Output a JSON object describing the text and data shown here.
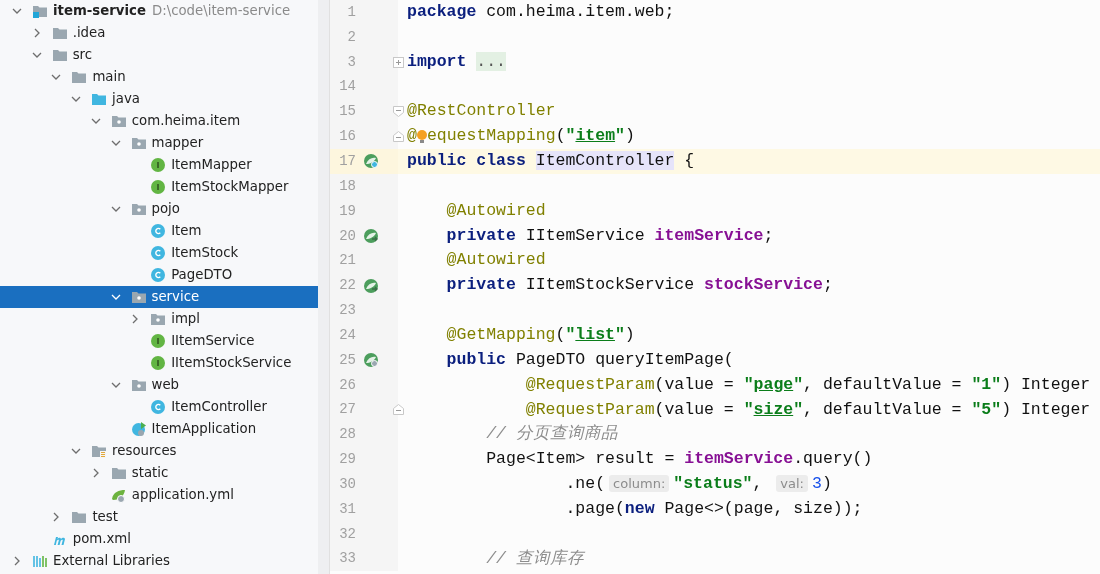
{
  "project_tree": [
    {
      "name": "item-service",
      "path": "D:\\code\\item-service",
      "kind": "module",
      "expanded": true,
      "selected": false,
      "children": [
        {
          "name": ".idea",
          "kind": "folder",
          "expanded": false,
          "selected": false
        },
        {
          "name": "src",
          "kind": "folder",
          "expanded": true,
          "selected": false,
          "children": [
            {
              "name": "main",
              "kind": "folder",
              "expanded": true,
              "selected": false,
              "children": [
                {
                  "name": "java",
                  "kind": "source-folder",
                  "expanded": true,
                  "selected": false,
                  "children": [
                    {
                      "name": "com.heima.item",
                      "kind": "package",
                      "expanded": true,
                      "selected": false,
                      "children": [
                        {
                          "name": "mapper",
                          "kind": "package",
                          "expanded": true,
                          "selected": false,
                          "children": [
                            {
                              "name": "ItemMapper",
                              "kind": "interface",
                              "selected": false
                            },
                            {
                              "name": "ItemStockMapper",
                              "kind": "interface",
                              "selected": false
                            }
                          ]
                        },
                        {
                          "name": "pojo",
                          "kind": "package",
                          "expanded": true,
                          "selected": false,
                          "children": [
                            {
                              "name": "Item",
                              "kind": "class",
                              "selected": false
                            },
                            {
                              "name": "ItemStock",
                              "kind": "class",
                              "selected": false
                            },
                            {
                              "name": "PageDTO",
                              "kind": "class",
                              "selected": false
                            }
                          ]
                        },
                        {
                          "name": "service",
                          "kind": "package",
                          "expanded": true,
                          "selected": true,
                          "children": [
                            {
                              "name": "impl",
                              "kind": "package",
                              "expanded": false,
                              "selected": false
                            },
                            {
                              "name": "IItemService",
                              "kind": "interface",
                              "selected": false
                            },
                            {
                              "name": "IItemStockService",
                              "kind": "interface",
                              "selected": false
                            }
                          ]
                        },
                        {
                          "name": "web",
                          "kind": "package",
                          "expanded": true,
                          "selected": false,
                          "children": [
                            {
                              "name": "ItemController",
                              "kind": "class",
                              "selected": false
                            }
                          ]
                        },
                        {
                          "name": "ItemApplication",
                          "kind": "spring-class",
                          "selected": false
                        }
                      ]
                    }
                  ]
                },
                {
                  "name": "resources",
                  "kind": "resources-folder",
                  "expanded": true,
                  "selected": false,
                  "children": [
                    {
                      "name": "static",
                      "kind": "folder",
                      "expanded": false,
                      "selected": false
                    },
                    {
                      "name": "application.yml",
                      "kind": "yml",
                      "selected": false
                    }
                  ]
                }
              ]
            },
            {
              "name": "test",
              "kind": "folder",
              "expanded": false,
              "selected": false
            }
          ]
        },
        {
          "name": "pom.xml",
          "kind": "maven",
          "selected": false
        }
      ]
    },
    {
      "name": "External Libraries",
      "kind": "libraries",
      "expanded": false,
      "selected": false
    }
  ],
  "editor": {
    "lines": [
      {
        "number": "1",
        "highlighted": false,
        "tokens": [
          {
            "kind": "keyword",
            "text": "package"
          },
          {
            "kind": "plain",
            "text": " com.heima.item.web;"
          }
        ]
      },
      {
        "number": "2",
        "highlighted": false
      },
      {
        "number": "3",
        "highlighted": false,
        "fold_marker": {
          "kind": "expand"
        },
        "tokens": [
          {
            "kind": "keyword",
            "text": "import "
          },
          {
            "kind": "folded",
            "text": "..."
          }
        ]
      },
      {
        "number": "14",
        "highlighted": false
      },
      {
        "number": "15",
        "highlighted": false,
        "fold_marker": {
          "kind": "collapse"
        },
        "tokens": [
          {
            "kind": "annotation",
            "text": "@RestController"
          }
        ]
      },
      {
        "number": "16",
        "highlighted": false,
        "fold_marker": {
          "kind": "end"
        },
        "tokens": [
          {
            "kind": "annotation",
            "text": "@"
          },
          {
            "kind": "bulb"
          },
          {
            "kind": "annotation",
            "text": "equestMapping"
          },
          {
            "kind": "plain",
            "text": "("
          },
          {
            "kind": "string",
            "text": "\""
          },
          {
            "kind": "string-link",
            "text": "item"
          },
          {
            "kind": "string",
            "text": "\""
          },
          {
            "kind": "plain",
            "text": ")"
          }
        ]
      },
      {
        "number": "17",
        "highlighted": true,
        "gutter_icon": {
          "kind": "bean-class"
        },
        "tokens": [
          {
            "kind": "keyword",
            "text": "public class "
          },
          {
            "kind": "usage",
            "text": "ItemController"
          },
          {
            "kind": "plain",
            "text": " {"
          }
        ]
      },
      {
        "number": "18",
        "highlighted": false
      },
      {
        "number": "19",
        "highlighted": false,
        "tokens": [
          {
            "kind": "annotation",
            "text": "    @Autowired"
          }
        ]
      },
      {
        "number": "20",
        "highlighted": false,
        "gutter_icon": {
          "kind": "bean-inject"
        },
        "tokens": [
          {
            "kind": "keyword",
            "text": "    private"
          },
          {
            "kind": "plain",
            "text": " IItemService "
          },
          {
            "kind": "field",
            "text": "itemService"
          },
          {
            "kind": "plain",
            "text": ";"
          }
        ]
      },
      {
        "number": "21",
        "highlighted": false,
        "tokens": [
          {
            "kind": "annotation",
            "text": "    @Autowired"
          }
        ]
      },
      {
        "number": "22",
        "highlighted": false,
        "gutter_icon": {
          "kind": "bean-inject"
        },
        "tokens": [
          {
            "kind": "keyword",
            "text": "    private"
          },
          {
            "kind": "plain",
            "text": " IItemStockService "
          },
          {
            "kind": "field",
            "text": "stockService"
          },
          {
            "kind": "plain",
            "text": ";"
          }
        ]
      },
      {
        "number": "23",
        "highlighted": false
      },
      {
        "number": "24",
        "highlighted": false,
        "tokens": [
          {
            "kind": "annotation",
            "text": "    @GetMapping"
          },
          {
            "kind": "plain",
            "text": "("
          },
          {
            "kind": "string",
            "text": "\""
          },
          {
            "kind": "string-link",
            "text": "list"
          },
          {
            "kind": "string",
            "text": "\""
          },
          {
            "kind": "plain",
            "text": ")"
          }
        ]
      },
      {
        "number": "25",
        "highlighted": false,
        "gutter_icon": {
          "kind": "bean-web"
        },
        "tokens": [
          {
            "kind": "keyword",
            "text": "    public"
          },
          {
            "kind": "plain",
            "text": " PageDTO queryItemPage("
          }
        ]
      },
      {
        "number": "26",
        "highlighted": false,
        "tokens": [
          {
            "kind": "annotation",
            "text": "            @RequestParam"
          },
          {
            "kind": "plain",
            "text": "(value = "
          },
          {
            "kind": "string",
            "text": "\""
          },
          {
            "kind": "string-link",
            "text": "page"
          },
          {
            "kind": "string",
            "text": "\""
          },
          {
            "kind": "plain",
            "text": ", defaultValue = "
          },
          {
            "kind": "string",
            "text": "\"1\""
          },
          {
            "kind": "plain",
            "text": ") Integer"
          }
        ]
      },
      {
        "number": "27",
        "highlighted": false,
        "fold_marker": {
          "kind": "end"
        },
        "tokens": [
          {
            "kind": "annotation",
            "text": "            @RequestParam"
          },
          {
            "kind": "plain",
            "text": "(value = "
          },
          {
            "kind": "string",
            "text": "\""
          },
          {
            "kind": "string-link",
            "text": "size"
          },
          {
            "kind": "string",
            "text": "\""
          },
          {
            "kind": "plain",
            "text": ", defaultValue = "
          },
          {
            "kind": "string",
            "text": "\"5\""
          },
          {
            "kind": "plain",
            "text": ") Integer"
          }
        ]
      },
      {
        "number": "28",
        "highlighted": false,
        "tokens": [
          {
            "kind": "comment",
            "text": "        // 分页查询商品"
          }
        ]
      },
      {
        "number": "29",
        "highlighted": false,
        "tokens": [
          {
            "kind": "plain",
            "text": "        Page<Item> result = "
          },
          {
            "kind": "field",
            "text": "itemService"
          },
          {
            "kind": "plain",
            "text": ".query()"
          }
        ]
      },
      {
        "number": "30",
        "highlighted": false,
        "tokens": [
          {
            "kind": "plain",
            "text": "                .ne("
          },
          {
            "kind": "hint",
            "text": "column:"
          },
          {
            "kind": "string",
            "text": "\"status\""
          },
          {
            "kind": "plain",
            "text": ", "
          },
          {
            "kind": "hint",
            "text": "val:"
          },
          {
            "kind": "number",
            "text": "3"
          },
          {
            "kind": "plain",
            "text": ")"
          }
        ]
      },
      {
        "number": "31",
        "highlighted": false,
        "tokens": [
          {
            "kind": "plain",
            "text": "                .page("
          },
          {
            "kind": "keyword",
            "text": "new"
          },
          {
            "kind": "plain",
            "text": " Page<>(page, size));"
          }
        ]
      },
      {
        "number": "32",
        "highlighted": false
      },
      {
        "number": "33",
        "highlighted": false,
        "tokens": [
          {
            "kind": "comment",
            "text": "        // 查询库存"
          }
        ]
      }
    ]
  }
}
